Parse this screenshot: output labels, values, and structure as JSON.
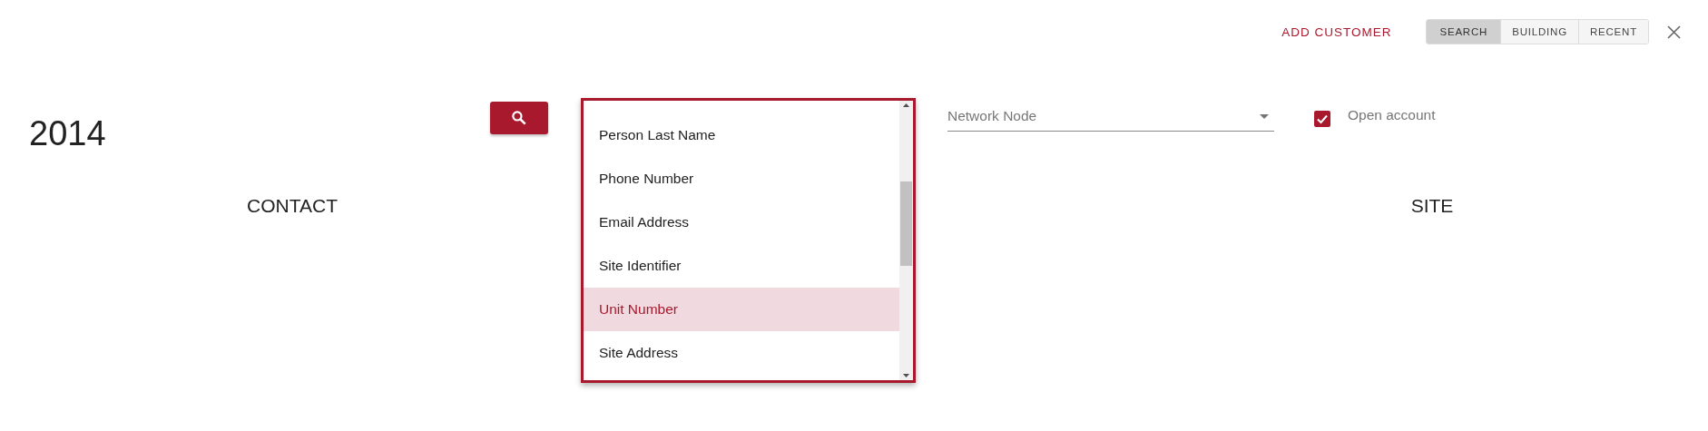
{
  "header": {
    "add_customer": "ADD CUSTOMER",
    "tabs": [
      {
        "label": "SEARCH",
        "selected": true
      },
      {
        "label": "BUILDING",
        "selected": false
      },
      {
        "label": "RECENT",
        "selected": false
      }
    ]
  },
  "search_bar": {
    "value": "2014",
    "dropdown": {
      "items": [
        {
          "label": "Person Last Name",
          "selected": false
        },
        {
          "label": "Phone Number",
          "selected": false
        },
        {
          "label": "Email Address",
          "selected": false
        },
        {
          "label": "Site Identifier",
          "selected": false
        },
        {
          "label": "Unit Number",
          "selected": true
        },
        {
          "label": "Site Address",
          "selected": false
        }
      ]
    },
    "network_node": {
      "placeholder": "Network Node"
    },
    "open_account": {
      "label": "Open account",
      "checked": true
    }
  },
  "sections": [
    "CONTACT",
    "SITE"
  ]
}
